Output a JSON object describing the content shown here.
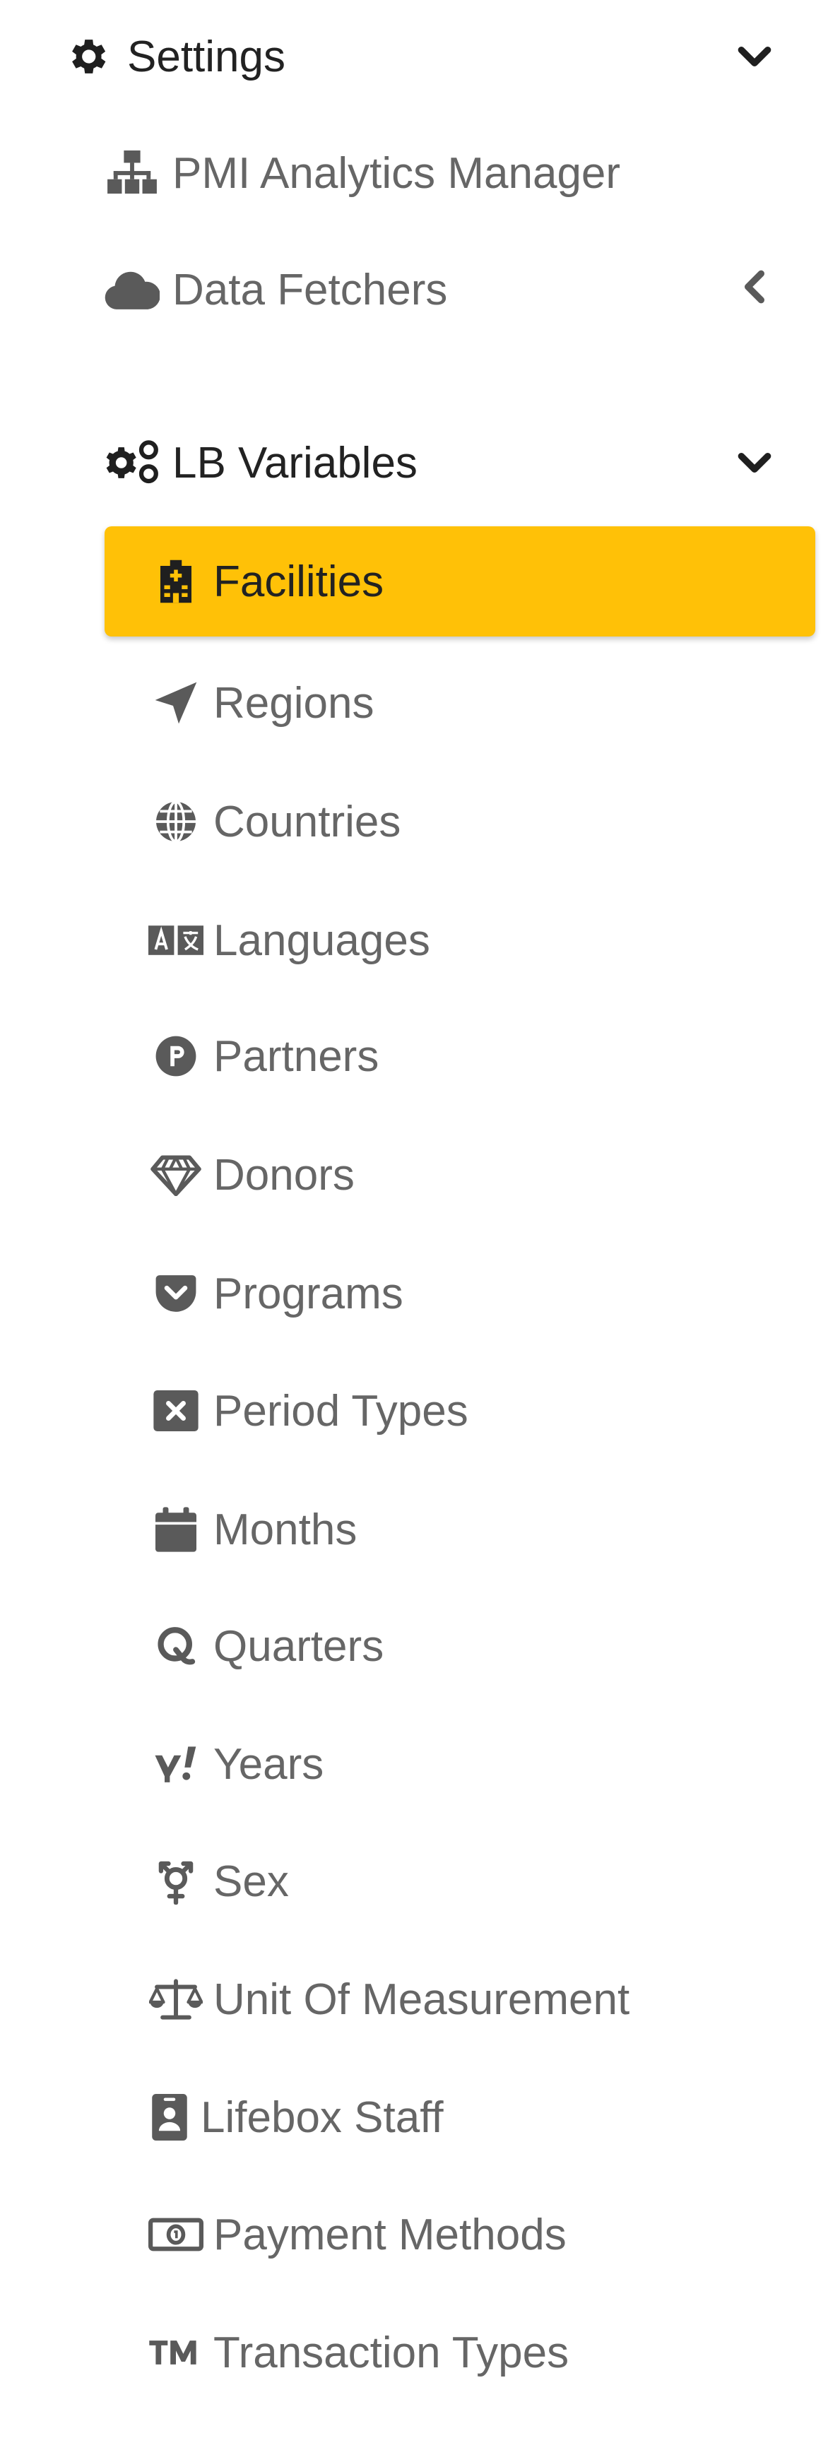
{
  "sidebar": {
    "settings": {
      "label": "Settings",
      "icon": "cog-icon",
      "expanded": true
    },
    "pmi": {
      "label": "PMI Analytics Manager",
      "icon": "sitemap-icon"
    },
    "fetchers": {
      "label": "Data Fetchers",
      "icon": "cloud-icon",
      "expanded": false
    },
    "lb_variables": {
      "label": "LB Variables",
      "icon": "cogs-icon",
      "expanded": true
    },
    "items": [
      {
        "label": "Facilities",
        "icon": "hospital-icon",
        "active": true
      },
      {
        "label": "Regions",
        "icon": "location-arrow-icon"
      },
      {
        "label": "Countries",
        "icon": "globe-icon"
      },
      {
        "label": "Languages",
        "icon": "language-icon"
      },
      {
        "label": "Partners",
        "icon": "product-hunt-icon"
      },
      {
        "label": "Donors",
        "icon": "gem-icon"
      },
      {
        "label": "Programs",
        "icon": "pocket-icon"
      },
      {
        "label": "Period Types",
        "icon": "window-close-icon"
      },
      {
        "label": "Months",
        "icon": "calendar-icon"
      },
      {
        "label": "Quarters",
        "icon": "quora-icon"
      },
      {
        "label": "Years",
        "icon": "yahoo-icon"
      },
      {
        "label": "Sex",
        "icon": "transgender-icon"
      },
      {
        "label": "Unit Of Measurement",
        "icon": "balance-scale-icon"
      },
      {
        "label": "Lifebox Staff",
        "icon": "id-badge-icon"
      },
      {
        "label": "Payment Methods",
        "icon": "money-bill-icon"
      },
      {
        "label": "Transaction Types",
        "icon": "trademark-icon"
      }
    ]
  },
  "colors": {
    "active_bg": "#FFC107",
    "text_dark": "#222222",
    "text_muted": "#666666",
    "icon_muted": "#5a5a5a"
  }
}
